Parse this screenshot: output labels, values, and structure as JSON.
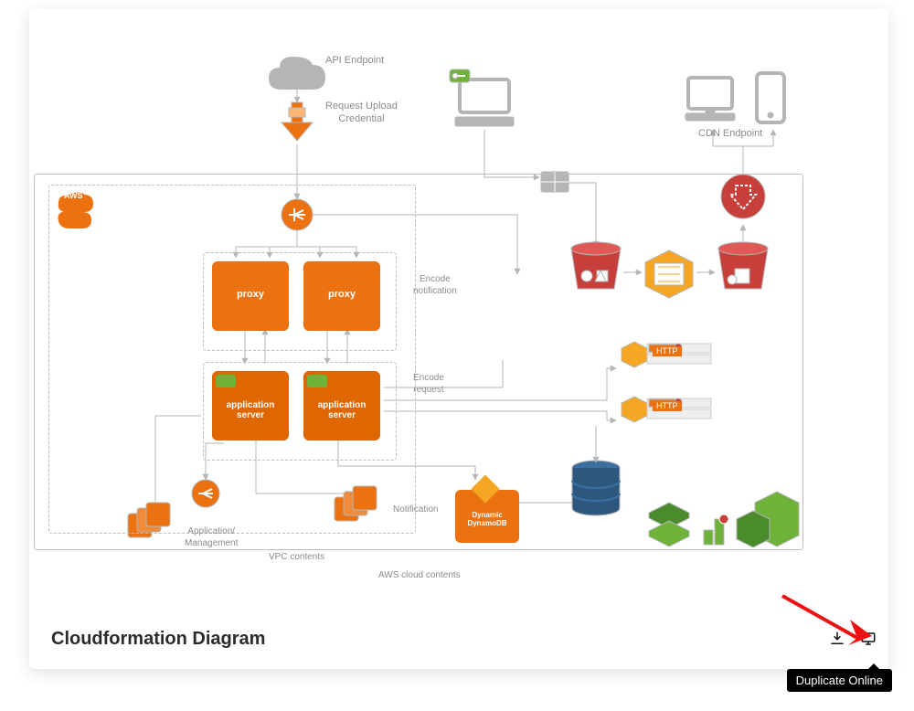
{
  "title": "Cloudformation Diagram",
  "toolbar": {
    "download_tip": "Download",
    "duplicate_tip": "Duplicate Online"
  },
  "badges": {
    "aws": "AWS"
  },
  "labels": {
    "api_endpoint": "API Endpoint",
    "request_upload": "Request Upload\nCredential",
    "cdn_endpoint": "CDN Endpoint",
    "encode_notification": "Encode\nnotification",
    "encode_request": "Encode\nrequest",
    "notification": "Notification",
    "app_mgmt": "Application/\nManagement",
    "vpc_contents": "VPC contents",
    "aws_contents": "AWS cloud contents",
    "http1": "HTTP",
    "http2": "HTTP"
  },
  "nodes": {
    "proxy1": "proxy",
    "proxy2": "proxy",
    "app1": "application\nserver",
    "app2": "application\nserver",
    "dynamo": "Dynamic\nDynamoDB"
  }
}
